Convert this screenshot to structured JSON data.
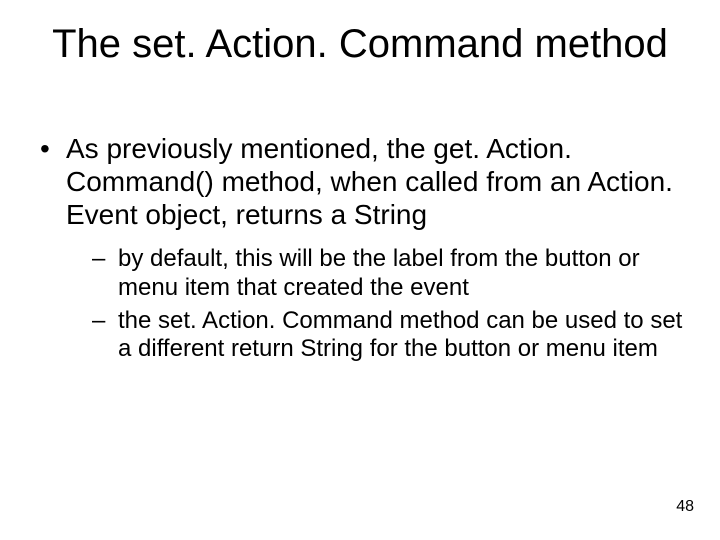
{
  "slide": {
    "title": "The set. Action. Command method",
    "bullets": [
      {
        "text": "As previously mentioned, the get. Action. Command() method, when called from an Action. Event object, returns a String",
        "sub": [
          "by default, this will be the label from the button or menu item that created the event",
          "the set. Action. Command method can be used to set a different return String for the button or menu item"
        ]
      }
    ],
    "page_number": "48"
  }
}
